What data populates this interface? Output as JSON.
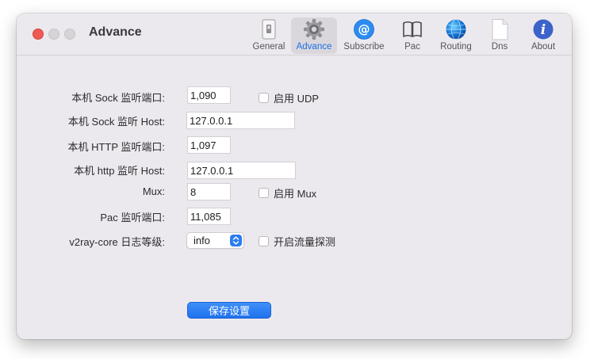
{
  "window": {
    "title": "Advance"
  },
  "toolbar": {
    "items": [
      {
        "label": "General",
        "icon": "general-switch-icon"
      },
      {
        "label": "Advance",
        "icon": "gear-icon",
        "selected": true
      },
      {
        "label": "Subscribe",
        "icon": "at-sign-icon"
      },
      {
        "label": "Pac",
        "icon": "open-book-icon"
      },
      {
        "label": "Routing",
        "icon": "globe-icon"
      },
      {
        "label": "Dns",
        "icon": "document-icon"
      },
      {
        "label": "About",
        "icon": "info-icon"
      }
    ]
  },
  "form": {
    "sock_port_label": "本机 Sock 监听端口:",
    "sock_port_value": "1,090",
    "udp_label": "启用 UDP",
    "udp_checked": false,
    "sock_host_label": "本机 Sock 监听 Host:",
    "sock_host_value": "127.0.0.1",
    "http_port_label": "本机 HTTP 监听端口:",
    "http_port_value": "1,097",
    "http_host_label": "本机 http 监听 Host:",
    "http_host_value": "127.0.0.1",
    "mux_label": "Mux:",
    "mux_value": "8",
    "enable_mux_label": "启用 Mux",
    "enable_mux_checked": false,
    "pac_port_label": "Pac 监听端口:",
    "pac_port_value": "11,085",
    "log_level_label": "v2ray-core 日志等级:",
    "log_level_value": "info",
    "traffic_label": "开启流量探测",
    "traffic_checked": false,
    "save_label": "保存设置"
  },
  "colors": {
    "accent": "#1f72ee",
    "close": "#ee5b54",
    "window_bg": "#ece9ee"
  }
}
